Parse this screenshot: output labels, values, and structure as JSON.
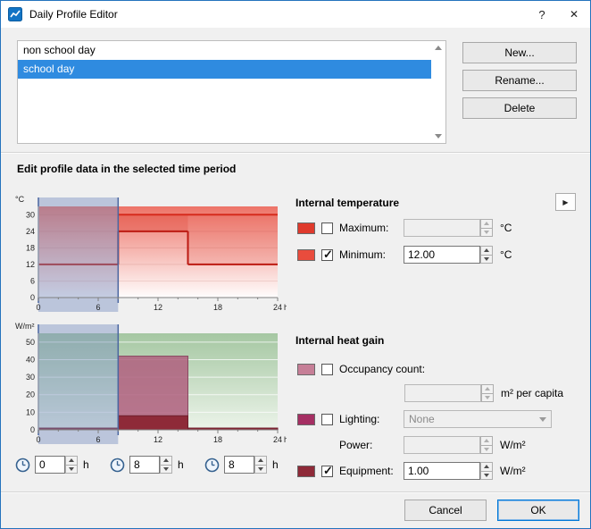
{
  "window": {
    "title": "Daily Profile Editor",
    "help_label": "?",
    "close_label": "✕"
  },
  "profile_list": {
    "items": [
      {
        "label": "non school day"
      },
      {
        "label": "school day"
      }
    ],
    "selected_index": 1
  },
  "actions": {
    "new_label": "New...",
    "rename_label": "Rename...",
    "delete_label": "Delete"
  },
  "edit_section": {
    "heading": "Edit profile data in the selected time period"
  },
  "temperature_panel": {
    "heading": "Internal temperature",
    "flyout_glyph": "▶",
    "maximum": {
      "label": "Maximum:",
      "checked": false,
      "value": "",
      "unit": "°C",
      "swatch_color": "#df3a2c"
    },
    "minimum": {
      "label": "Minimum:",
      "checked": true,
      "value": "12.00",
      "unit": "°C",
      "swatch_color": "#e94c3d"
    }
  },
  "heat_gain_panel": {
    "heading": "Internal heat gain",
    "occupancy": {
      "label": "Occupancy count:",
      "checked": false,
      "value": "",
      "unit": "m² per capita",
      "swatch_color": "#c67f97"
    },
    "lighting": {
      "label": "Lighting:",
      "checked": false,
      "value": "None",
      "swatch_color": "#a52f63"
    },
    "power": {
      "label": "Power:",
      "value": "",
      "unit": "W/m²"
    },
    "equipment": {
      "label": "Equipment:",
      "checked": true,
      "value": "1.00",
      "unit": "W/m²",
      "swatch_color": "#8e2a38"
    }
  },
  "time_fields": [
    {
      "value": "0",
      "unit": "h"
    },
    {
      "value": "8",
      "unit": "h"
    },
    {
      "value": "8",
      "unit": "h"
    }
  ],
  "footer": {
    "cancel_label": "Cancel",
    "ok_label": "OK"
  },
  "chart_data": [
    {
      "type": "area",
      "title": "Internal temperature daily profile",
      "ylabel": "°C",
      "xlabel": "h",
      "xlim": [
        0,
        24
      ],
      "ylim": [
        0,
        33
      ],
      "xticks": [
        0,
        6,
        12,
        18,
        24
      ],
      "yticks": [
        0,
        6,
        12,
        18,
        24,
        30
      ],
      "selection": [
        0,
        8
      ],
      "selection_fill": "rgba(114,138,190,0.42)",
      "selection_line": "#4a66a0",
      "bg_top": "#ed7468",
      "bg_bottom": "#fffdfd",
      "grid_color": "rgba(150,40,30,0.12)",
      "bands": [
        {
          "x0": 8,
          "x1": 15,
          "y0": 24,
          "y1": 30,
          "color": "#dd3b2e",
          "opacity": 0.35
        },
        {
          "x0": 15,
          "x1": 24,
          "y0": 12,
          "y1": 30,
          "color": "#dd3b2e",
          "opacity": 0.15
        }
      ],
      "series": [
        {
          "name": "maximum",
          "render": "line",
          "color": "#d62b1d",
          "steps": [
            {
              "x0": 8,
              "x1": 24,
              "y": 30
            }
          ]
        },
        {
          "name": "minimum",
          "render": "line",
          "color": "#bc1a12",
          "steps": [
            {
              "x0": 0,
              "x1": 8,
              "y": 12
            },
            {
              "x0": 8,
              "x1": 15,
              "y": 24
            },
            {
              "x0": 15,
              "x1": 24,
              "y": 12
            }
          ]
        }
      ]
    },
    {
      "type": "bar",
      "title": "Internal heat gain daily profile",
      "ylabel": "W/m²",
      "xlabel": "h",
      "xlim": [
        0,
        24
      ],
      "ylim": [
        0,
        55
      ],
      "xticks": [
        0,
        6,
        12,
        18,
        24
      ],
      "yticks": [
        0,
        10,
        20,
        30,
        40,
        50
      ],
      "selection": [
        0,
        8
      ],
      "selection_fill": "rgba(114,138,190,0.42)",
      "selection_line": "#4a66a0",
      "bg_top": "#a5c7a2",
      "bg_bottom": "#ecf4ea",
      "grid_color": "rgba(255,255,255,0.75)",
      "bands": [],
      "series": [
        {
          "name": "occupancy",
          "render": "bar",
          "color": "#af5f7e",
          "opacity": 0.85,
          "stroke": "#8a4a63",
          "steps": [
            {
              "x0": 8,
              "x1": 15,
              "y": 42
            }
          ]
        },
        {
          "name": "equipment",
          "render": "bar",
          "color": "#8e2a38",
          "opacity": 1,
          "stroke": "#6e1f2c",
          "steps": [
            {
              "x0": 0,
              "x1": 8,
              "y": 1
            },
            {
              "x0": 8,
              "x1": 15,
              "y": 8
            },
            {
              "x0": 15,
              "x1": 24,
              "y": 1
            }
          ]
        }
      ]
    }
  ]
}
